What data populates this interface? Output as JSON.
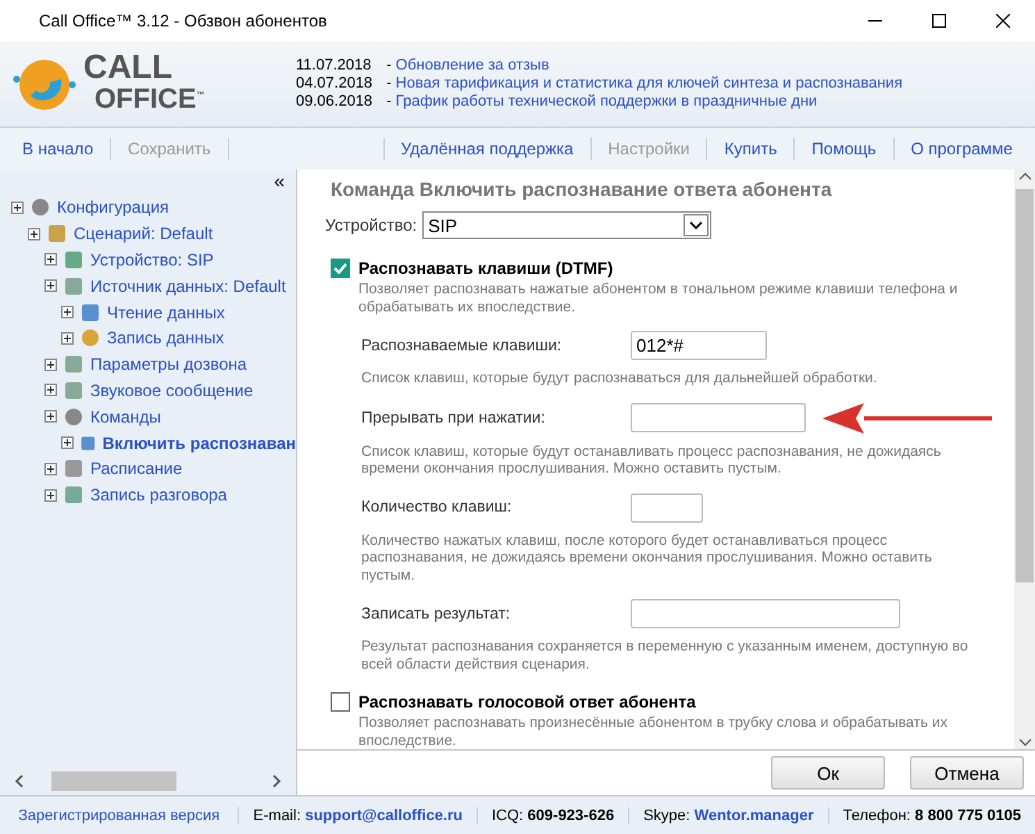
{
  "window": {
    "title": "Call Office™ 3.12 - Обзвон абонентов"
  },
  "logo": {
    "line_1": "CALL",
    "line_2": "OFFICE",
    "mark": "™"
  },
  "news": [
    {
      "date": "11.07.2018",
      "dash": "-",
      "text": "Обновление за отзыв"
    },
    {
      "date": "04.07.2018",
      "dash": "-",
      "text": "Новая тарификация и статистика для ключей синтеза и распознавания"
    },
    {
      "date": "09.06.2018",
      "dash": "-",
      "text": "График работы технической поддержки в праздничные дни"
    }
  ],
  "toolbar": [
    {
      "kind": "item",
      "label": "В начало",
      "disabled": false
    },
    {
      "kind": "item",
      "label": "Сохранить",
      "disabled": true
    },
    {
      "kind": "gap"
    },
    {
      "kind": "item",
      "label": "Удалённая поддержка",
      "disabled": false
    },
    {
      "kind": "item",
      "label": "Настройки",
      "disabled": true
    },
    {
      "kind": "item",
      "label": "Купить",
      "disabled": false
    },
    {
      "kind": "item",
      "label": "Помощь",
      "disabled": false
    },
    {
      "kind": "item",
      "label": "О программе",
      "disabled": false
    }
  ],
  "sidebar": {
    "collapse": "«",
    "tree": [
      {
        "label": "Конфигурация",
        "selected": false,
        "children": [
          {
            "label": "Сценарий: Default",
            "selected": false,
            "children": [
              {
                "label": "Устройство: SIP",
                "selected": false
              },
              {
                "label": "Источник данных: Default",
                "selected": false,
                "children": [
                  {
                    "label": "Чтение данных",
                    "selected": false
                  },
                  {
                    "label": "Запись данных",
                    "selected": false
                  }
                ]
              },
              {
                "label": "Параметры дозвона",
                "selected": false
              },
              {
                "label": "Звуковое сообщение",
                "selected": false
              },
              {
                "label": "Команды",
                "selected": false,
                "children": [
                  {
                    "label": "Включить распознаван",
                    "selected": true
                  }
                ]
              },
              {
                "label": "Расписание",
                "selected": false
              },
              {
                "label": "Запись разговора",
                "selected": false
              }
            ]
          }
        ]
      }
    ]
  },
  "form": {
    "title": "Команда Включить распознавание ответа абонента",
    "device": {
      "label": "Устройство:",
      "value": "SIP"
    },
    "sections": [
      {
        "checked": true,
        "title": "Распознавать клавиши (DTMF)",
        "description": "Позволяет распознавать нажатые абонентом в тональном режиме клавиши телефона и обрабатывать их впоследствие.",
        "fields": [
          {
            "label": "Распознаваемые клавиши:",
            "value": "012*#",
            "hint": "Список клавиш, которые будут распознаваться для дальнейшей обработки.",
            "arrow": false
          },
          {
            "label": "Прерывать при нажатии:",
            "hint": "Список клавиш, которые будут останавливать процесс распознавания, не дожидаясь времени окончания прослушивания. Можно оставить пустым.",
            "arrow": true
          },
          {
            "label": "Количество клавиш:",
            "hint": "Количество нажатых клавиш, после которого будет останавливаться процесс распознавания, не дожидаясь времени окончания прослушивания. Можно оставить пустым.",
            "arrow": false
          },
          {
            "label": "Записать результат:",
            "hint": "Результат распознавания сохраняется в переменную с указанным именем, доступную во всей области действия сценария.",
            "arrow": false
          }
        ]
      },
      {
        "checked": false,
        "title": "Распознавать голосовой ответ абонента",
        "description": "Позволяет распознавать произнесённые абонентом в трубку слова и обрабатывать их впоследствие."
      }
    ]
  },
  "buttons": [
    "Ок",
    "Отмена"
  ],
  "status_bar": {
    "version": "Зарегистрированная версия",
    "items": [
      {
        "label": "E-mail:",
        "value": "support@calloffice.ru",
        "kind": "link"
      },
      {
        "label": "ICQ:",
        "value": "609-923-626",
        "kind": "text"
      },
      {
        "label": "Skype:",
        "value": "Wentor.manager",
        "kind": "link"
      },
      {
        "label": "Телефон:",
        "value": "8 800 775 0105",
        "kind": "text"
      }
    ]
  }
}
